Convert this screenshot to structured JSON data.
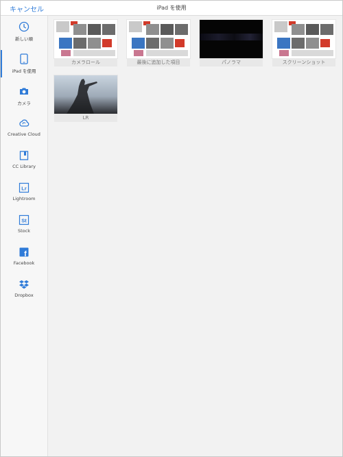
{
  "header": {
    "cancel_label": "キャンセル",
    "title": "iPad を使用"
  },
  "sidebar": {
    "items": [
      {
        "label": "新しい順",
        "icon": "clock-icon"
      },
      {
        "label": "iPad を使用",
        "icon": "ipad-icon",
        "active": true
      },
      {
        "label": "カメラ",
        "icon": "camera-icon"
      },
      {
        "label": "Creative Cloud",
        "icon": "creative-cloud-icon"
      },
      {
        "label": "CC Library",
        "icon": "cc-library-icon"
      },
      {
        "label": "Lightroom",
        "icon": "lightroom-icon",
        "badge": "Lr"
      },
      {
        "label": "Stock",
        "icon": "stock-icon",
        "badge": "St"
      },
      {
        "label": "Facebook",
        "icon": "facebook-icon",
        "badge": "f"
      },
      {
        "label": "Dropbox",
        "icon": "dropbox-icon"
      }
    ]
  },
  "albums": [
    {
      "label": "カメラロール"
    },
    {
      "label": "最後に追加した項目"
    },
    {
      "label": "パノラマ"
    },
    {
      "label": "スクリーンショット"
    },
    {
      "label": "LR"
    }
  ],
  "colors": {
    "accent": "#2f7bd8",
    "sidebar_bg": "#f7f7f7",
    "content_bg": "#f2f2f2"
  }
}
